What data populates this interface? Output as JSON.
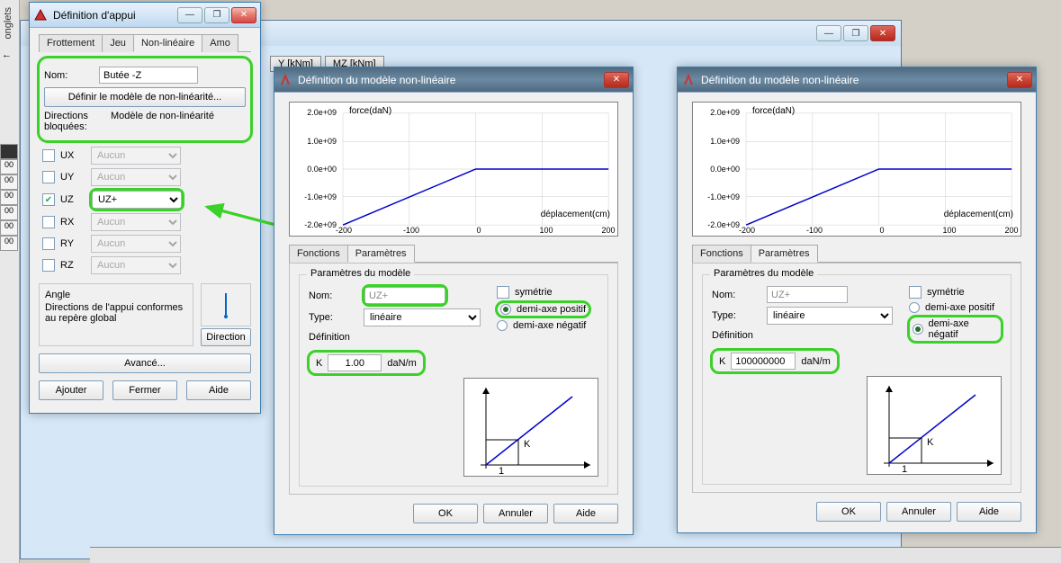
{
  "bg": {
    "tab_my": "Y [kNm]",
    "tab_mz": "MZ [kNm]"
  },
  "sidebar": {
    "vtab": "onglets",
    "arrow": "←",
    "gridvals": [
      "00",
      "00",
      "00",
      "00",
      "00",
      "00"
    ]
  },
  "supportDef": {
    "title": "Définition d'appui",
    "tabs": [
      "Frottement",
      "Jeu",
      "Non-linéaire",
      "Amo"
    ],
    "activeTab": 2,
    "nameLabel": "Nom:",
    "nameValue": "Butée -Z",
    "defineBtn": "Définir le modèle de non-linéarité...",
    "dirLabel": "Directions bloquées:",
    "modelLabel": "Modèle de non-linéarité",
    "dof": [
      {
        "name": "UX",
        "checked": false,
        "model": "Aucun",
        "enabled": false
      },
      {
        "name": "UY",
        "checked": false,
        "model": "Aucun",
        "enabled": false
      },
      {
        "name": "UZ",
        "checked": true,
        "model": "UZ+",
        "enabled": true
      },
      {
        "name": "RX",
        "checked": false,
        "model": "Aucun",
        "enabled": false
      },
      {
        "name": "RY",
        "checked": false,
        "model": "Aucun",
        "enabled": false
      },
      {
        "name": "RZ",
        "checked": false,
        "model": "Aucun",
        "enabled": false
      }
    ],
    "angleLabel": "Angle",
    "angleText": "Directions de l'appui conformes au repère global",
    "directionBtn": "Direction",
    "advancedBtn": "Avancé...",
    "addBtn": "Ajouter",
    "closeBtn": "Fermer",
    "helpBtn": "Aide"
  },
  "nlModel": {
    "title": "Définition du modèle non-linéaire",
    "tabs": [
      "Fonctions",
      "Paramètres"
    ],
    "activeTab": 1,
    "groupTitle": "Paramètres du modèle",
    "nameLabel": "Nom:",
    "typeLabel": "Type:",
    "defLabel": "Définition",
    "typeOptions": [
      "linéaire"
    ],
    "sym": "symétrie",
    "axPos": "demi-axe positif",
    "axNeg": "demi-axe négatif",
    "kUnit": "daN/m",
    "okBtn": "OK",
    "cancelBtn": "Annuler",
    "helpBtn": "Aide"
  },
  "modelA": {
    "name": "UZ+",
    "type": "linéaire",
    "axis": "pos",
    "k": "1.00"
  },
  "modelB": {
    "name": "UZ+",
    "type": "linéaire",
    "axis": "neg",
    "k": "100000000"
  },
  "chart_data": [
    {
      "type": "line",
      "title": "",
      "xlabel": "déplacement(cm)",
      "ylabel": "force(daN)",
      "xticks": [
        -200.0,
        -100.0,
        0.0,
        100.0,
        200.0
      ],
      "yticks": [
        -2000000000.0,
        -1000000000.0,
        0.0,
        1000000000.0,
        2000000000.0
      ],
      "ytick_labels": [
        "-2.0e+09",
        "-1.0e+09",
        "0.0e+00",
        "1.0e+09",
        "2.0e+09"
      ],
      "xlim": [
        -200,
        200
      ],
      "ylim": [
        -2000000000.0,
        2000000000.0
      ],
      "series": [
        {
          "name": "curve",
          "x": [
            -200,
            0,
            200
          ],
          "y": [
            -2000000000.0,
            0,
            0
          ],
          "color": "#0000cc"
        }
      ],
      "note": "demi-axe positif model — force is zero for x>=0, linear negative slope for x<0"
    },
    {
      "type": "line",
      "title": "",
      "xlabel": "déplacement(cm)",
      "ylabel": "force(daN)",
      "xticks": [
        -200.0,
        -100.0,
        0.0,
        100.0,
        200.0
      ],
      "yticks": [
        -2000000000.0,
        -1000000000.0,
        0.0,
        1000000000.0,
        2000000000.0
      ],
      "ytick_labels": [
        "-2.0e+09",
        "-1.0e+09",
        "0.0e+00",
        "1.0e+09",
        "2.0e+09"
      ],
      "xlim": [
        -200,
        200
      ],
      "ylim": [
        -2000000000.0,
        2000000000.0
      ],
      "series": [
        {
          "name": "curve",
          "x": [
            -200,
            0,
            200
          ],
          "y": [
            -2000000000.0,
            0,
            0
          ],
          "color": "#0000cc"
        }
      ],
      "note": "same shape shown for demi-axe négatif panel"
    }
  ]
}
